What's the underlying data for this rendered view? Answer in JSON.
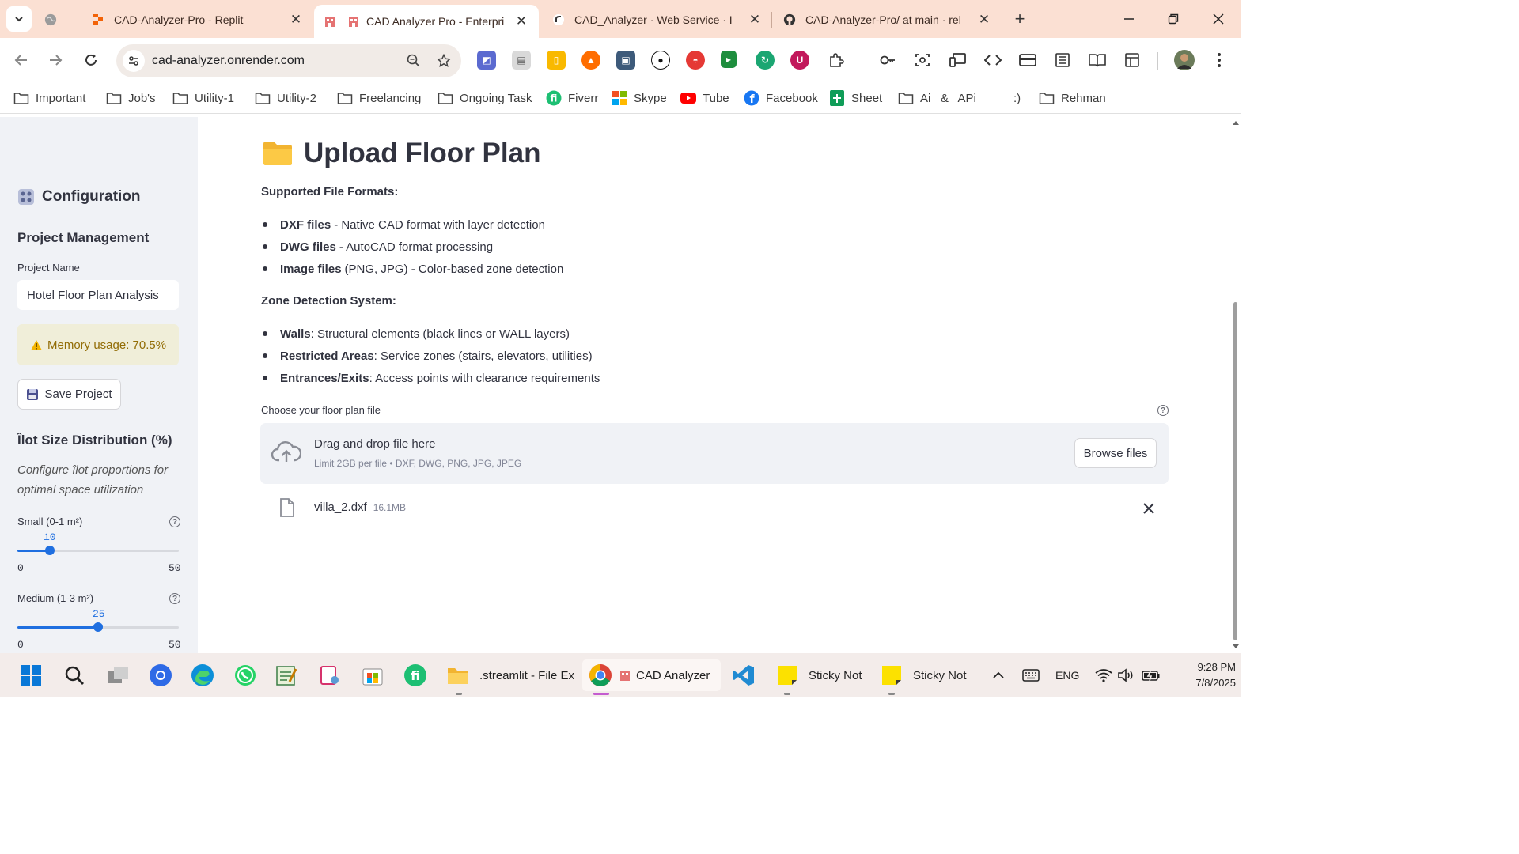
{
  "browser": {
    "tabs": [
      {
        "title": "CAD-Analyzer-Pro - Replit",
        "active": false
      },
      {
        "title": "CAD Analyzer Pro - Enterpri",
        "active": true
      },
      {
        "title": "CAD_Analyzer · Web Service · I",
        "active": false
      },
      {
        "title": "CAD-Analyzer-Pro/ at main · rel",
        "active": false
      }
    ],
    "url": "cad-analyzer.onrender.com",
    "bookmarks": [
      "Important",
      "Job's",
      "Utility-1",
      "Utility-2",
      "Freelancing",
      "Ongoing Task",
      "Fiverr",
      "Skype",
      "Tube",
      "Facebook",
      "Sheet",
      "Ai   &   APi",
      ":)",
      "Rehman"
    ]
  },
  "sidebar": {
    "title": "Configuration",
    "section_project": "Project Management",
    "project_name_label": "Project Name",
    "project_name_value": "Hotel Floor Plan Analysis",
    "memory_warning": "Memory usage: 70.5%",
    "save_button": "Save Project",
    "section_ilot": "Îlot Size Distribution (%)",
    "ilot_caption": "Configure îlot proportions for optimal space utilization",
    "sliders": [
      {
        "label": "Small (0-1 m²)",
        "value": "10",
        "min": "0",
        "max": "50",
        "fraction": 0.2
      },
      {
        "label": "Medium (1-3 m²)",
        "value": "25",
        "min": "0",
        "max": "50",
        "fraction": 0.5
      }
    ]
  },
  "main": {
    "title": "Upload Floor Plan",
    "formats_heading": "Supported File Formats:",
    "formats": [
      {
        "bold": "DXF files",
        "rest": "- Native CAD format with layer detection"
      },
      {
        "bold": "DWG files",
        "rest": "- AutoCAD format processing"
      },
      {
        "bold": "Image files",
        "rest": "(PNG, JPG) - Color-based zone detection"
      }
    ],
    "zones_heading": "Zone Detection System:",
    "zones": [
      {
        "bold": "Walls",
        "rest": ": Structural elements (black lines or WALL layers)"
      },
      {
        "bold": "Restricted Areas",
        "rest": ": Service zones (stairs, elevators, utilities)"
      },
      {
        "bold": "Entrances/Exits",
        "rest": ": Access points with clearance requirements"
      }
    ],
    "uploader_label": "Choose your floor plan file",
    "drop_text": "Drag and drop file here",
    "drop_limit": "Limit 2GB per file • DXF, DWG, PNG, JPG, JPEG",
    "browse_button": "Browse files",
    "file_name": "villa_2.dxf",
    "file_size": "16.1MB"
  },
  "taskbar": {
    "apps": [
      ".streamlit - File Ex",
      "CAD Analyzer",
      "Sticky Not",
      "Sticky Not"
    ],
    "lang": "ENG",
    "time": "9:28 PM",
    "date": "7/8/2025"
  },
  "colors": {
    "accent": "#1f6fe0",
    "sidebar_bg": "#f0f2f6",
    "warning_bg": "#f0eed9",
    "warning_text": "#926c05",
    "tabstrip_bg": "#fbe0d3"
  }
}
